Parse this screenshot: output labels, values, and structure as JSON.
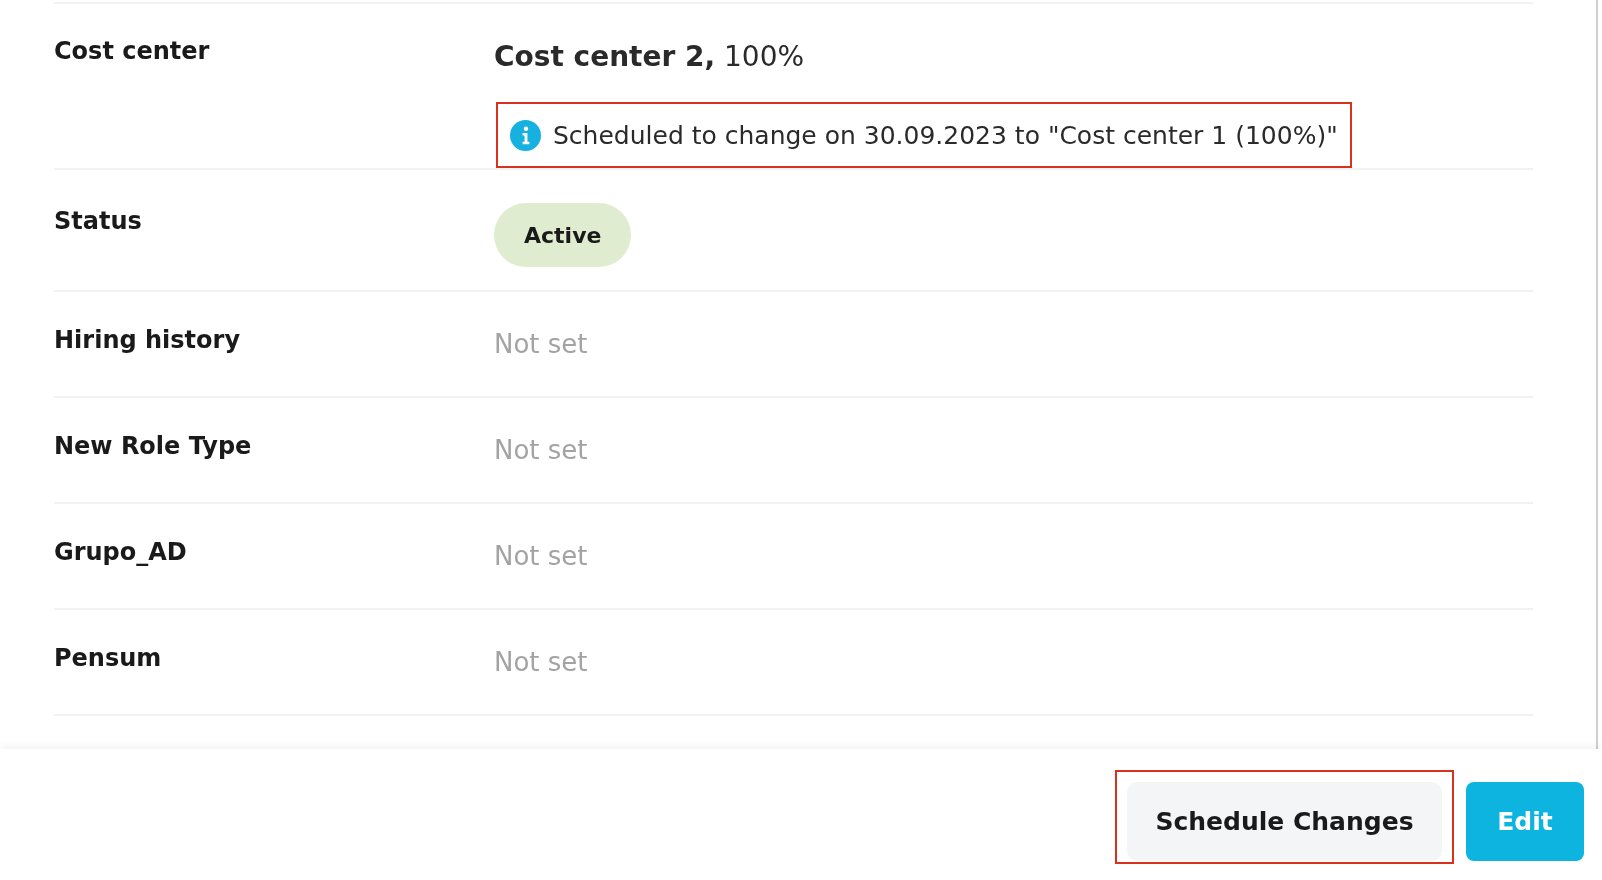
{
  "fields": [
    {
      "kind": "allocation",
      "label": "Cost center",
      "value": "**Cost center 2,** 100%",
      "note": {
        "text": "Scheduled to change on 30.09.2023 to \"Cost center 1 (100%)\"",
        "highlighted": true
      }
    },
    {
      "kind": "status",
      "label": "Status",
      "value": "Active"
    },
    {
      "kind": "text",
      "label": "Hiring history",
      "value": "Not set",
      "set": false
    },
    {
      "kind": "text",
      "label": "New Role Type",
      "value": "Not set",
      "set": false
    },
    {
      "kind": "text",
      "label": "Grupo_AD",
      "value": "Not set",
      "set": false
    },
    {
      "kind": "text",
      "label": "Pensum",
      "value": "Not set",
      "set": false
    }
  ],
  "footer": {
    "buttons": [
      {
        "kind": "secondary",
        "label": "Schedule Changes",
        "highlighted": true
      },
      {
        "kind": "primary",
        "label": "Edit",
        "highlighted": false
      }
    ]
  }
}
